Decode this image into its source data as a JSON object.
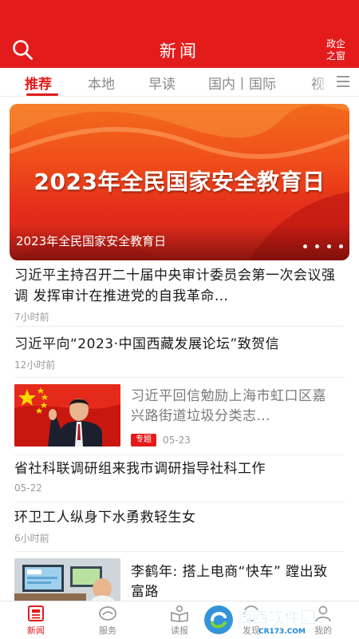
{
  "header": {
    "title": "新闻",
    "gov_window_line1": "政企",
    "gov_window_line2": "之窗",
    "search_icon": "search-icon",
    "color": "#e31b1b"
  },
  "tabs": {
    "items": [
      "推荐",
      "本地",
      "早读",
      "国内丨国际",
      "视"
    ],
    "active": "推荐",
    "menu_icon": "menu-icon"
  },
  "banner": {
    "headline": "2023年全民国家安全教育日",
    "caption": "2023年全民国家安全教育日",
    "slide_count": 4
  },
  "feed": {
    "item1": {
      "title": "习近平主持召开二十届中央审计委员会第一次会议强调 发挥审计在推进党的自我革命…",
      "time": "7小时前"
    },
    "item2": {
      "title": "习近平向“2023·中国西藏发展论坛”致贺信",
      "time": "12小时前"
    },
    "item3": {
      "title": "习近平回信勉励上海市虹口区嘉兴路街道垃圾分类志…",
      "badge": "专题",
      "date": "05-23"
    },
    "item4": {
      "title": "省社科联调研组来我市调研指导社科工作",
      "date": "05-22"
    },
    "item5": {
      "title": "环卫工人纵身下水勇救轻生女",
      "time": "6小时前"
    },
    "item6": {
      "title": "李鹤年: 搭上电商“快车” 蹚出致富路"
    }
  },
  "bottom_nav": {
    "items": [
      {
        "label": "新闻",
        "icon": "newspaper-icon"
      },
      {
        "label": "服务",
        "icon": "service-icon"
      },
      {
        "label": "读报",
        "icon": "read-paper-icon"
      },
      {
        "label": "发现",
        "icon": "discover-icon"
      },
      {
        "label": "我的",
        "icon": "profile-icon"
      }
    ],
    "active": "新闻"
  },
  "watermark": {
    "brand": "西西软件园",
    "site": "CR173.COM"
  }
}
